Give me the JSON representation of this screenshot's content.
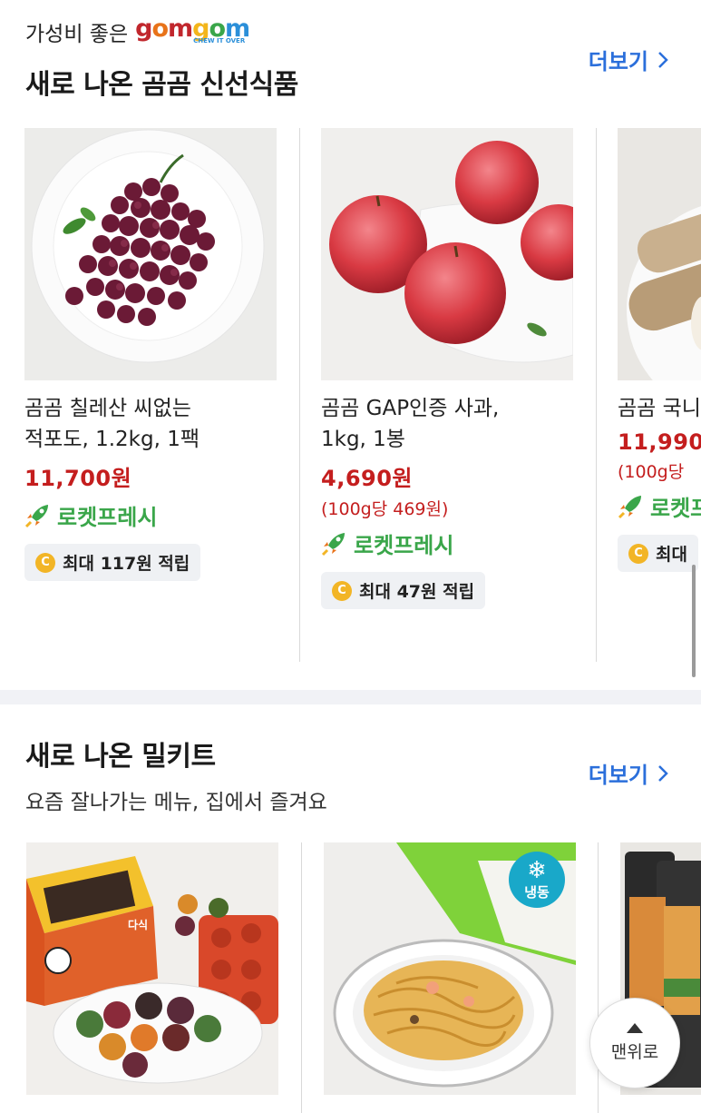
{
  "section1": {
    "brand_prefix": "가성비 좋은",
    "brand_logo": {
      "letters": [
        {
          "ch": "g",
          "color": "#c1272d"
        },
        {
          "ch": "o",
          "color": "#e8731a"
        },
        {
          "ch": "m",
          "color": "#c1272d"
        },
        {
          "ch": "g",
          "color": "#f3b51b"
        },
        {
          "ch": "o",
          "color": "#3aa64a"
        },
        {
          "ch": "m",
          "color": "#2b8fd9"
        }
      ],
      "tagline": "CHEW IT OVER"
    },
    "title": "새로 나온 곰곰 신선식품",
    "more_label": "더보기",
    "products": [
      {
        "name": "곰곰 칠레산 씨없는\n적포도, 1.2kg, 1팩",
        "price": "11,700원",
        "unit_price": "",
        "delivery": "로켓프레시",
        "reward": "최대 117원 적립",
        "image": "grapes"
      },
      {
        "name": "곰곰 GAP인증 사과,\n1kg, 1봉",
        "price": "4,690원",
        "unit_price": "(100g당 469원)",
        "delivery": "로켓프레시",
        "reward": "최대 47원 적립",
        "image": "apples"
      },
      {
        "name": "곰곰 국니",
        "price": "11,990",
        "unit_price": "(100g당",
        "delivery": "로켓프레",
        "reward": "최대",
        "image": "yam"
      }
    ]
  },
  "section2": {
    "title": "새로 나온 밀키트",
    "subtitle": "요즘 잘나가는 메뉴, 집에서 즐겨요",
    "more_label": "더보기",
    "products": [
      {
        "image": "cakes",
        "box_label": "다식"
      },
      {
        "image": "pasta",
        "badge": "냉동"
      },
      {
        "image": "kimbap"
      }
    ]
  },
  "top_button_label": "맨위로",
  "colors": {
    "price": "#c41e1e",
    "rocket": "#3aa64a",
    "more": "#2b6fdb",
    "coin": "#f2b526"
  },
  "icons": [
    "rocket-icon",
    "coin-icon",
    "chevron-right-icon",
    "snowflake-icon",
    "arrow-up-icon"
  ]
}
